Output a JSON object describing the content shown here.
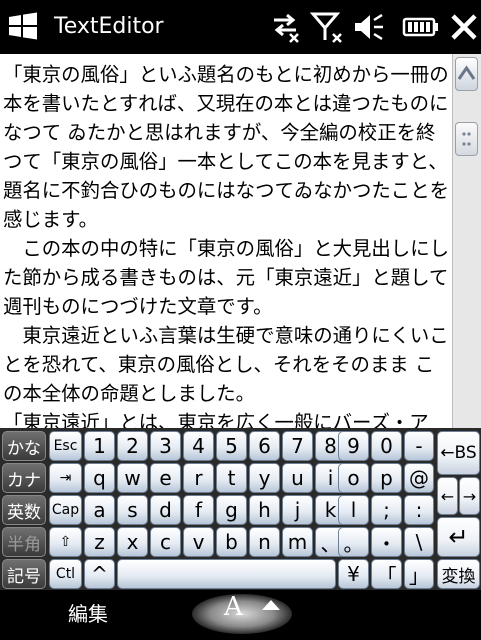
{
  "window": {
    "title": "TextEditor"
  },
  "editor": {
    "paragraphs": [
      "「東京の風俗」といふ題名のもとに初めから一冊の本を書いたとすれば、又現在の本とは違つたものになつて ゐたかと思はれますが、今全編の校正を終つて「東京の風俗」一本としてこの本を見ますと、題名に不釣合ひのものにはなつてゐなかつたことを感じます。",
      "　この本の中の特に「東京の風俗」と大見出しにした節から成る書きものは、元「東京遠近」と題して週刊ものにつづけた文章です。",
      "　東京遠近といふ言葉は生硬で意味の通りにくいことを恐れて、東京の風俗とし、それをそのまま この本全体の命題としました。",
      "「東京遠近」とは、東京を広く一般にバーズ・ア"
    ]
  },
  "keyboard": {
    "row1": [
      "かな",
      "Esc",
      "1",
      "2",
      "3",
      "4",
      "5",
      "6",
      "7",
      "8",
      "9",
      "0",
      "-",
      "←BS"
    ],
    "row2": [
      "カナ",
      "⇥",
      "q",
      "w",
      "e",
      "r",
      "t",
      "y",
      "u",
      "i",
      "o",
      "p",
      "@"
    ],
    "row3": [
      "英数",
      "Cap",
      "a",
      "s",
      "d",
      "f",
      "g",
      "h",
      "j",
      "k",
      "l",
      ";",
      ":"
    ],
    "row4": [
      "半角",
      "⇧",
      "z",
      "x",
      "c",
      "v",
      "b",
      "n",
      "m",
      "、",
      "。",
      "・",
      "\\"
    ],
    "row5": [
      "記号",
      "Ctl",
      "^",
      "",
      "¥",
      "「",
      "」",
      "変換"
    ],
    "arrows": {
      "left": "←",
      "right": "→",
      "enter": "↵"
    }
  },
  "softbar": {
    "left_label": "編集",
    "input_mode": "A"
  }
}
